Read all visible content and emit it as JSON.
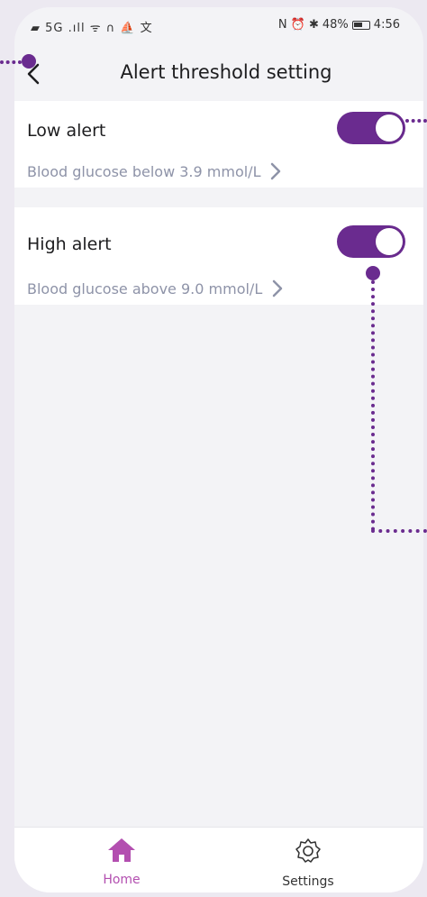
{
  "status_bar": {
    "left_icons": "▰ 5G .ıll ᯤ ∩ ⛵ 文",
    "right_icons": "N ⏰ ✱",
    "battery": "48%",
    "time": "4:56"
  },
  "header": {
    "title": "Alert threshold setting"
  },
  "alerts": {
    "low": {
      "label": "Low alert",
      "description": "Blood glucose below 3.9 mmol/L",
      "enabled": true
    },
    "high": {
      "label": "High alert",
      "description": "Blood glucose above 9.0 mmol/L",
      "enabled": true
    }
  },
  "tabbar": {
    "home": "Home",
    "settings": "Settings"
  },
  "colors": {
    "accent": "#6a2b8f",
    "tab_active": "#b34fb0",
    "subtext": "#8e93a8"
  }
}
